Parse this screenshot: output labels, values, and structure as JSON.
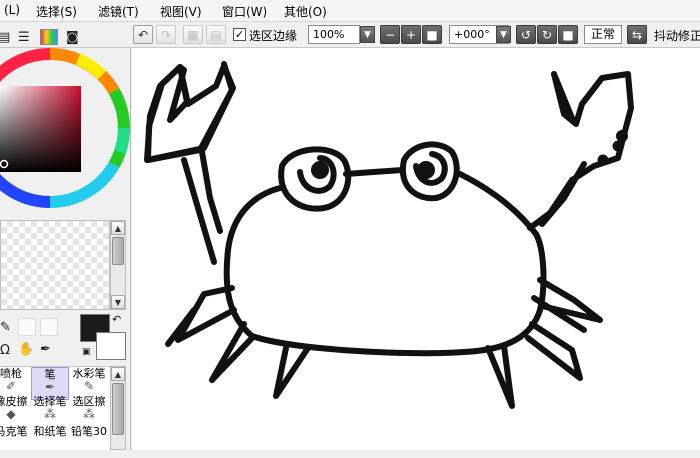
{
  "menubar": {
    "items": [
      "(L)",
      "选择(S)",
      "滤镜(T)",
      "视图(V)",
      "窗口(W)",
      "其他(O)"
    ]
  },
  "toolbar": {
    "undo_icon": "undo-icon",
    "redo_icon": "redo-icon",
    "select_edge_label": "选区边缘",
    "select_edge_checked": true,
    "zoom_value": "100%",
    "rotation_value": "+000°",
    "blend_mode": "正常",
    "stabilizer_label": "抖动修正"
  },
  "left_panel": {
    "tool_palette": {
      "rows": [
        [
          "喷枪",
          "笔",
          "水彩笔"
        ],
        [
          "橡皮擦",
          "选择笔",
          "选区擦"
        ],
        [
          "马克笔",
          "和纸笔",
          "铅笔30"
        ]
      ],
      "active": "笔"
    },
    "colors": {
      "primary": "#1a1a1a",
      "secondary": "#ffffff",
      "selected_hue": "#c8102e"
    }
  },
  "canvas": {
    "background": "#ffffff",
    "drawing": "crab-line-drawing"
  }
}
